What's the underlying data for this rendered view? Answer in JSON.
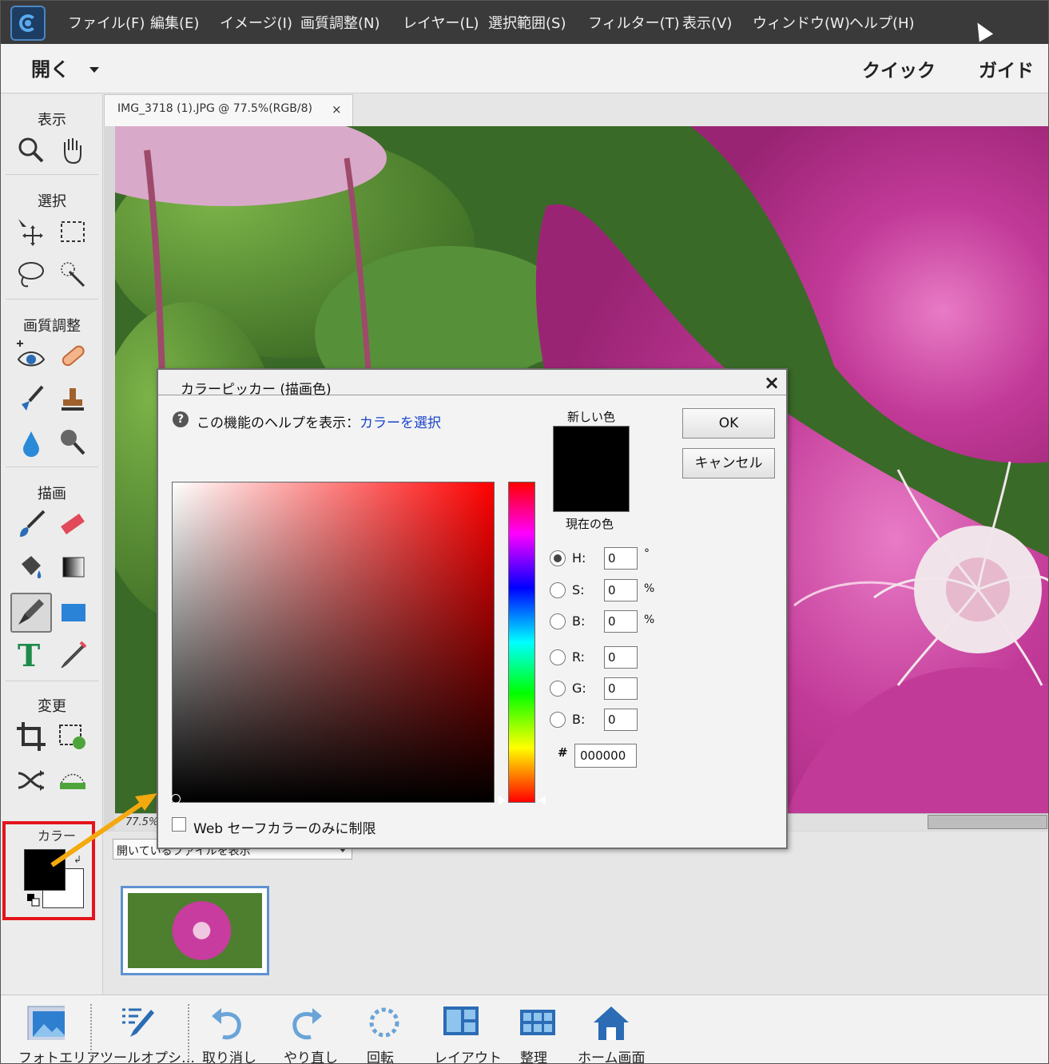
{
  "menu": [
    "ファイル(F)",
    "編集(E)",
    "イメージ(I)",
    "画質調整(N)",
    "レイヤー(L)",
    "選択範囲(S)",
    "フィルター(T)",
    "表示(V)",
    "ウィンドウ(W)",
    "ヘルプ(H)"
  ],
  "topbar": {
    "open_label": "開く",
    "quick_label": "クイック",
    "guide_label": "ガイド"
  },
  "toolbox": {
    "view_heading": "表示",
    "select_heading": "選択",
    "enhance_heading": "画質調整",
    "draw_heading": "描画",
    "modify_heading": "変更",
    "color_heading": "カラー"
  },
  "document": {
    "tab_title": "IMG_3718 (1).JPG @ 77.5%(RGB/8)",
    "tab_close": "×",
    "zoom": "77.5%"
  },
  "bin": {
    "dropdown": "開いているファイルを表示"
  },
  "taskbar": {
    "photo_area": "フォトエリア",
    "tool_options": "ツールオプシ…",
    "undo": "取り消し",
    "redo": "やり直し",
    "rotate": "回転",
    "layout": "レイアウト",
    "organize": "整理",
    "home": "ホーム画面"
  },
  "dialog": {
    "title": "カラーピッカー (描画色)",
    "close": "×",
    "help_prefix": "この機能のヘルプを表示：",
    "help_link": "カラーを選択",
    "new_color_label": "新しい色",
    "current_color_label": "現在の色",
    "ok": "OK",
    "cancel": "キャンセル",
    "fields": {
      "h_label": "H:",
      "h_value": "0",
      "h_unit": "°",
      "s_label": "S:",
      "s_value": "0",
      "s_unit": "%",
      "b_label": "B:",
      "b_value": "0",
      "b_unit": "%",
      "r_label": "R:",
      "r_value": "0",
      "g_label": "G:",
      "g_value": "0",
      "b2_label": "B:",
      "b2_value": "0",
      "hash": "#",
      "hex_value": "000000"
    },
    "web_safe_label": "Web セーフカラーのみに制限"
  },
  "colors": {
    "foreground": "#000000",
    "background": "#ffffff",
    "highlight": "#e3141d",
    "arrow": "#f4a90f"
  }
}
